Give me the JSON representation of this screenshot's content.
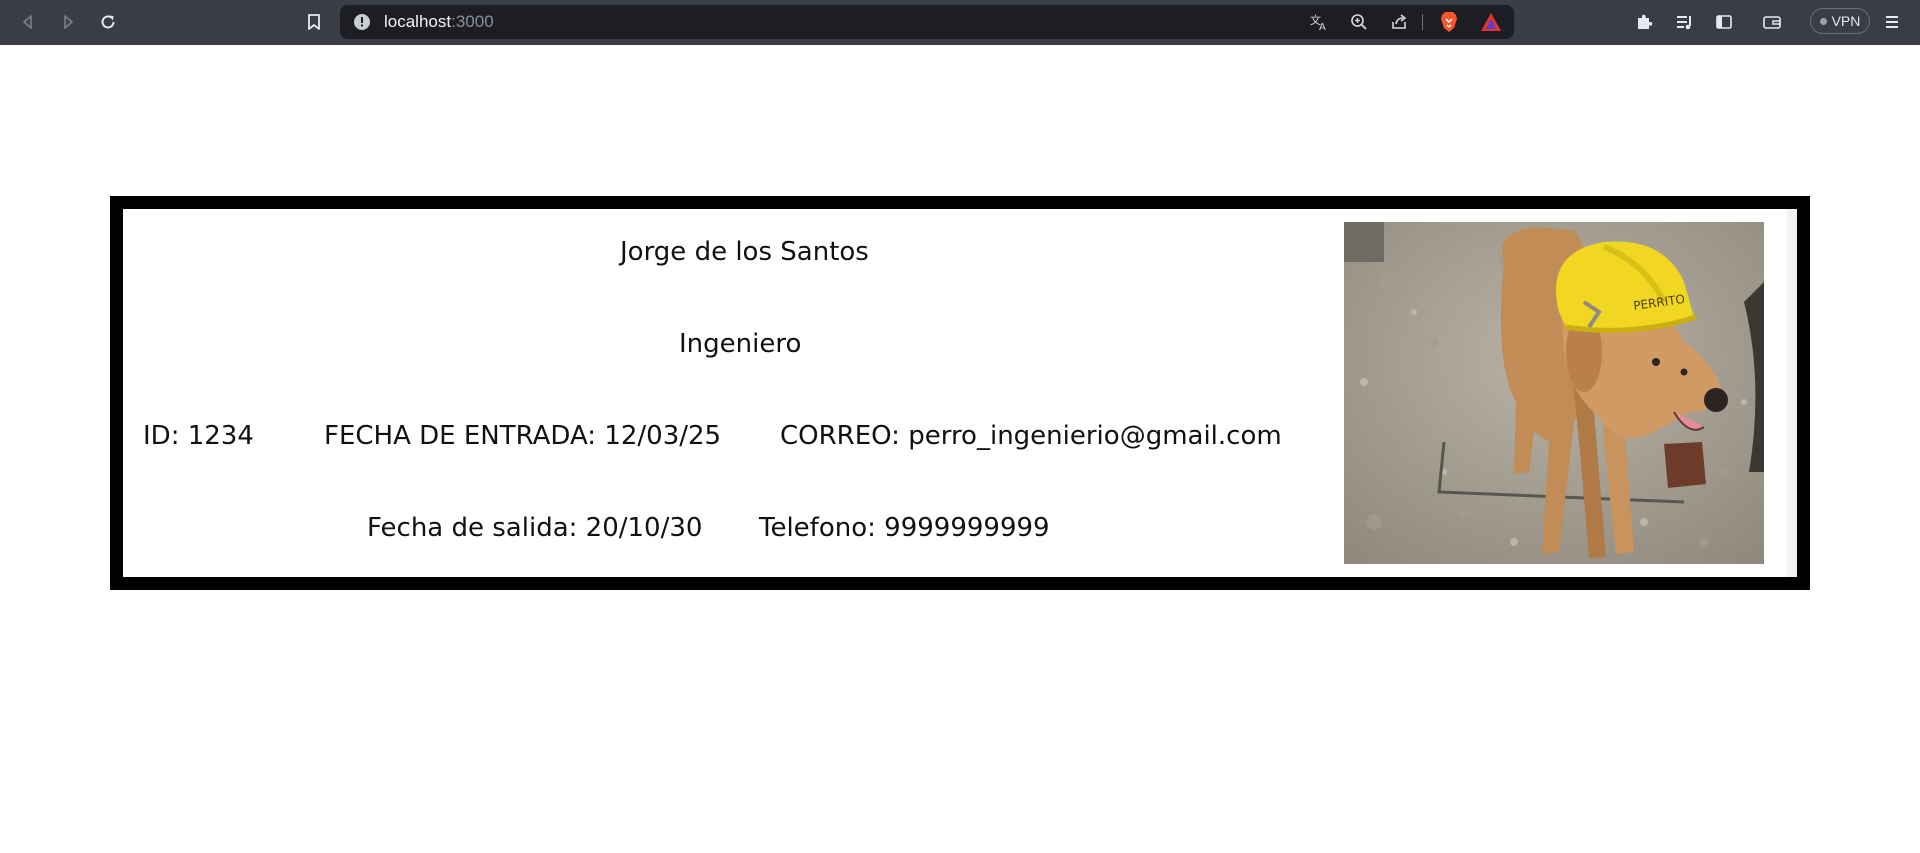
{
  "browser": {
    "url_host": "localhost",
    "url_port": ":3000",
    "vpn_label": "VPN"
  },
  "card": {
    "name": "Jorge de los Santos",
    "role": "Ingeniero",
    "id": "ID: 1234",
    "entry_date": "FECHA DE ENTRADA: 12/03/25",
    "email": "CORREO: perro_ingenierio@gmail.com",
    "exit_date": "Fecha de salida: 20/10/30",
    "phone": "Telefono: 9999999999",
    "helmet_text": "PERRITO"
  },
  "colors": {
    "chrome_bg": "#3a3d48",
    "omnibox_bg": "#1c1e24",
    "card_border": "#000000",
    "helmet": "#f2d722"
  }
}
